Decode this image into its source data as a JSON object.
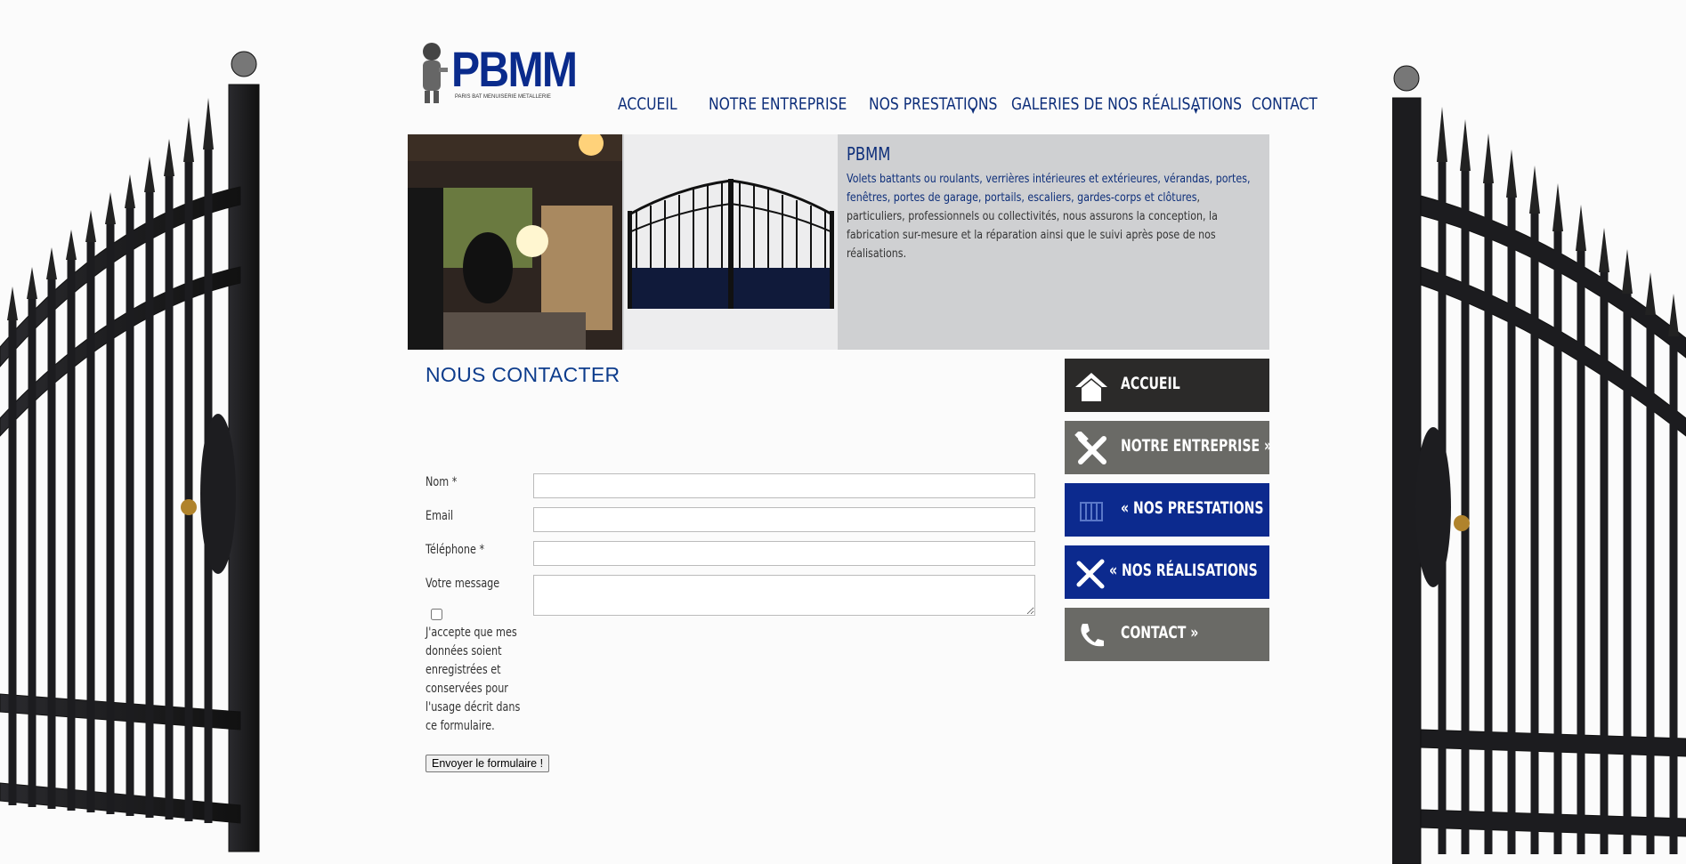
{
  "logo": {
    "name": "PBMM",
    "tagline": "PARIS BAT MENUISERIE METALLERIE"
  },
  "topnav": [
    {
      "label": "ACCUEIL",
      "has_submenu": false
    },
    {
      "label": "NOTRE ENTREPRISE",
      "has_submenu": false
    },
    {
      "label": "NOS PRESTATIONS",
      "has_submenu": true
    },
    {
      "label": "GALERIES DE NOS RÉALISATIONS",
      "has_submenu": true
    },
    {
      "label": "CONTACT",
      "has_submenu": false
    }
  ],
  "banner": {
    "title": "PBMM",
    "highlight": "Volets battants ou roulants, verrières intérieures et extérieures, vérandas, portes, fenêtres, portes de garage, portails, escaliers, gardes-corps et clôtures",
    "desc": ", particuliers, professionnels ou collectivités, nous assurons la conception, la fabrication sur-mesure et la réparation ainsi que le suivi après pose de nos réalisations."
  },
  "page": {
    "title": "NOUS CONTACTER"
  },
  "form": {
    "name_label": "Nom *",
    "email_label": "Email",
    "phone_label": "Téléphone *",
    "message_label": "Votre message",
    "consent": "J'accepte que mes données soient enregistrées et conservées pour l'usage décrit dans ce formulaire.",
    "submit": "Envoyer le formulaire !"
  },
  "sidemenu": [
    {
      "label": "ACCUEIL",
      "icon": "home-icon",
      "bg": "#2b2a29"
    },
    {
      "label": "NOTRE ENTREPRISE »",
      "icon": "tools-icon",
      "bg": "#6a6a66"
    },
    {
      "label": "« NOS PRESTATIONS",
      "icon": "gate-icon",
      "bg": "#0c2a8e"
    },
    {
      "label": "« NOS RÉALISATIONS",
      "icon": "ruler-pencil-icon",
      "bg": "#0c2a8e"
    },
    {
      "label": "CONTACT »",
      "icon": "phone-icon",
      "bg": "#6a6a66"
    }
  ]
}
